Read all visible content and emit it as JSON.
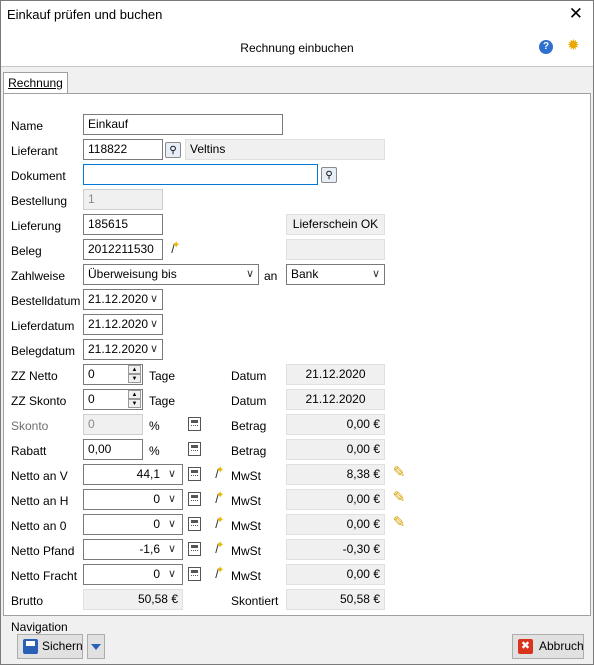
{
  "window": {
    "title": "Einkauf prüfen und buchen",
    "close_glyph": "✕"
  },
  "header": {
    "title": "Rechnung einbuchen",
    "help_glyph": "?",
    "settings_glyph": "✹"
  },
  "tabs": [
    {
      "label": "Rechnung"
    }
  ],
  "form": {
    "name": {
      "label": "Name",
      "value": "Einkauf"
    },
    "lieferant": {
      "label": "Lieferant",
      "value": "118822",
      "name": "Veltins"
    },
    "dokument": {
      "label": "Dokument",
      "value": ""
    },
    "bestellung": {
      "label": "Bestellung",
      "value": "1"
    },
    "lieferung": {
      "label": "Lieferung",
      "value": "185615",
      "status": "Lieferschein OK"
    },
    "beleg": {
      "label": "Beleg",
      "value": "2012211530",
      "extra": ""
    },
    "zahlweise": {
      "label": "Zahlweise",
      "value": "Überweisung bis",
      "an_label": "an",
      "an_value": "Bank"
    },
    "bestelldatum": {
      "label": "Bestelldatum",
      "value": "21.12.2020"
    },
    "lieferdatum": {
      "label": "Lieferdatum",
      "value": "21.12.2020"
    },
    "belegdatum": {
      "label": "Belegdatum",
      "value": "21.12.2020"
    },
    "zz_netto": {
      "label": "ZZ Netto",
      "value": "0",
      "unit": "Tage",
      "datum_label": "Datum",
      "datum": "21.12.2020"
    },
    "zz_skonto": {
      "label": "ZZ Skonto",
      "value": "0",
      "unit": "Tage",
      "datum_label": "Datum",
      "datum": "21.12.2020"
    },
    "skonto": {
      "label": "Skonto",
      "value": "0",
      "unit": "%",
      "betrag_label": "Betrag",
      "betrag": "0,00 €"
    },
    "rabatt": {
      "label": "Rabatt",
      "value": "0,00",
      "unit": "%",
      "betrag_label": "Betrag",
      "betrag": "0,00 €"
    },
    "netto_rows": [
      {
        "label": "Netto an V",
        "value": "44,1",
        "mwst_label": "MwSt",
        "mwst": "8,38 €",
        "editable": true
      },
      {
        "label": "Netto an H",
        "value": "0",
        "mwst_label": "MwSt",
        "mwst": "0,00 €",
        "editable": true
      },
      {
        "label": "Netto an 0",
        "value": "0",
        "mwst_label": "MwSt",
        "mwst": "0,00 €",
        "editable": true
      },
      {
        "label": "Netto Pfand",
        "value": "-1,6",
        "mwst_label": "MwSt",
        "mwst": "-0,30 €",
        "editable": false
      },
      {
        "label": "Netto Fracht",
        "value": "0",
        "mwst_label": "MwSt",
        "mwst": "0,00 €",
        "editable": false
      }
    ],
    "brutto": {
      "label": "Brutto",
      "value": "50,58 €",
      "skontiert_label": "Skontiert",
      "skontiert": "50,58 €"
    }
  },
  "footer": {
    "navigation_label": "Navigation",
    "save_label": "Sichern",
    "cancel_label": "Abbruch"
  }
}
